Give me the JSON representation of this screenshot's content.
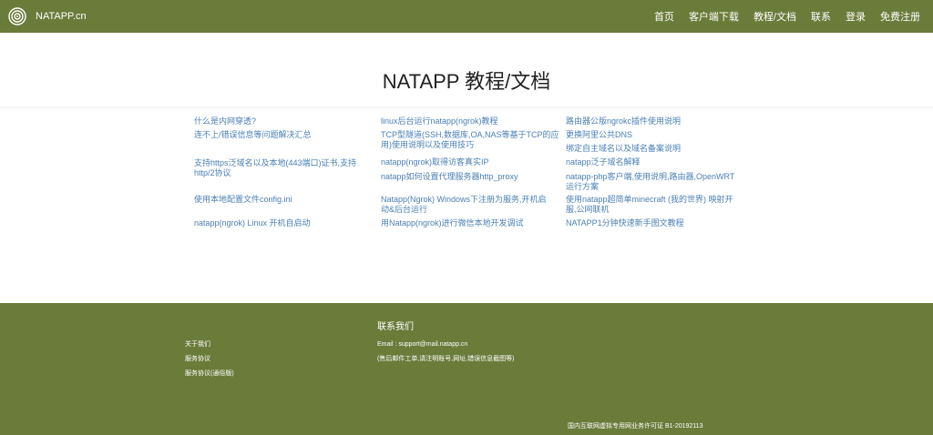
{
  "nav": {
    "brand": "NATAPP.cn",
    "brand_icon": "spiral-logo-icon",
    "links": [
      "首页",
      "客户端下载",
      "教程/文档",
      "联系",
      "登录",
      "免费注册"
    ]
  },
  "page": {
    "title": "NATAPP 教程/文档"
  },
  "docs": {
    "col1": [
      "什么是内网穿透?",
      "连不上/错误信息等问题解决汇总",
      [
        "支持https泛域名以及本地(443端口)证书,支持",
        "http/2协议"
      ],
      "使用本地配置文件config.ini",
      "natapp(ngrok) Linux 开机自启动"
    ],
    "col2": [
      "linux后台运行natapp(ngrok)教程",
      [
        "TCP型隧道(SSH,数据库,OA,NAS等基于TCP的应",
        "用)使用说明以及使用技巧"
      ],
      "natapp(ngrok)取得访客真实IP",
      "natapp如何设置代理服务器http_proxy",
      [
        "Natapp(Ngrok) Windows下注册为服务,开机启",
        "动&后台运行"
      ],
      "用Natapp(ngrok)进行微信本地开发调试"
    ],
    "col3": [
      "路由器公版ngrokc插件使用说明",
      "更换阿里公共DNS",
      "绑定自主域名以及域名备案说明",
      "natapp泛子域名解释",
      [
        "natapp-php客户端,使用说明,路由器,OpenWRT",
        "运行方案"
      ],
      [
        "使用natapp超简单minecraft (我的世界) 映射开",
        "服,公网联机"
      ],
      "NATAPP1分钟快速新手图文教程"
    ]
  },
  "footer": {
    "links": [
      "关于我们",
      "服务协议",
      "服务协议(通俗版)"
    ],
    "contact_title": "联系我们",
    "email": "Email : support@mail.natapp.cn",
    "note": "(售后邮件工单,请注明账号,网址,错误信息截图等)",
    "license": "国内互联网虚拟专用网业务许可证 B1-20192113"
  },
  "colors": {
    "header_bg": "#6b7b3a",
    "link": "#4a7fb5"
  }
}
